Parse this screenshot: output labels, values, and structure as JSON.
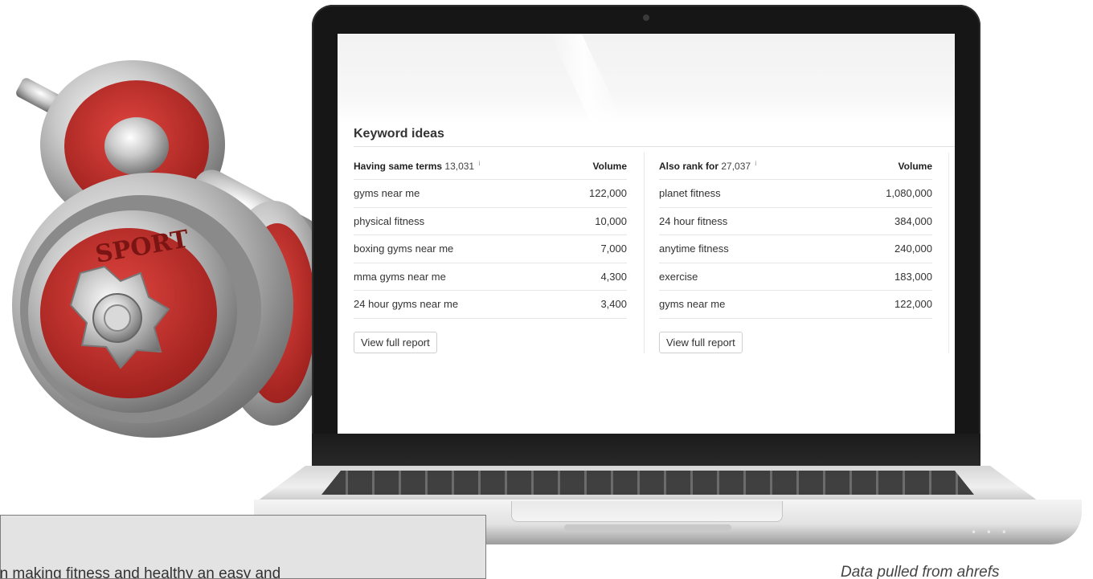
{
  "keyword_ideas": {
    "title": "Keyword ideas",
    "left": {
      "header_label": "Having same terms",
      "header_count": "13,031",
      "info_marker": "i",
      "volume_label": "Volume",
      "rows": [
        {
          "keyword": "gyms near me",
          "volume": "122,000"
        },
        {
          "keyword": "physical fitness",
          "volume": "10,000"
        },
        {
          "keyword": "boxing gyms near me",
          "volume": "7,000"
        },
        {
          "keyword": "mma gyms near me",
          "volume": "4,300"
        },
        {
          "keyword": "24 hour gyms near me",
          "volume": "3,400"
        }
      ],
      "button_label": "View full report"
    },
    "right": {
      "header_label": "Also rank for",
      "header_count": "27,037",
      "info_marker": "i",
      "volume_label": "Volume",
      "rows": [
        {
          "keyword": "planet fitness",
          "volume": "1,080,000"
        },
        {
          "keyword": "24 hour fitness",
          "volume": "384,000"
        },
        {
          "keyword": "anytime fitness",
          "volume": "240,000"
        },
        {
          "keyword": "exercise",
          "volume": "183,000"
        },
        {
          "keyword": "gyms near me",
          "volume": "122,000"
        }
      ],
      "button_label": "View full report"
    }
  },
  "illustration": {
    "plate_text": "SPORT",
    "plate_text_2": "SPORT",
    "colors": {
      "plate_red": "#c8302c",
      "chrome": "#bdbdbd"
    }
  },
  "laptop": {
    "trackpad_dots": "• • •"
  },
  "caption": {
    "text": "on making fitness and healthy an easy and"
  },
  "data_note": {
    "text": "Data pulled from ahrefs"
  }
}
